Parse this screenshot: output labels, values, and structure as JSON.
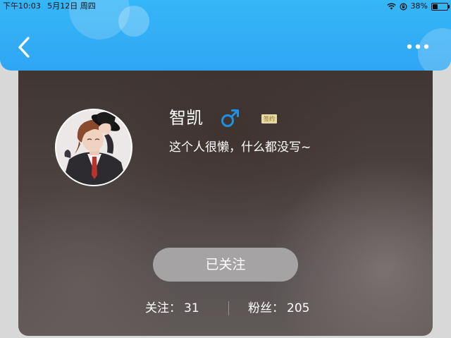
{
  "status_bar": {
    "time": "下午10:03",
    "date": "5月12日 周四",
    "battery": "38%",
    "battery_level": 0.38
  },
  "nav": {
    "back_icon": "chevron-left-icon",
    "more_icon": "more-dots-icon"
  },
  "profile": {
    "name": "智凯",
    "gender_icon": "male-icon",
    "tag": "签约",
    "signature": "这个人很懒，什么都没写~",
    "follow_button": "已关注"
  },
  "stats": {
    "following_label": "关注：",
    "following_value": "31",
    "followers_label": "粉丝：",
    "followers_value": "205"
  },
  "colors": {
    "header": "#2fa6f3",
    "male_icon": "#1e90e6",
    "follow_button": "#a5a3a4"
  }
}
